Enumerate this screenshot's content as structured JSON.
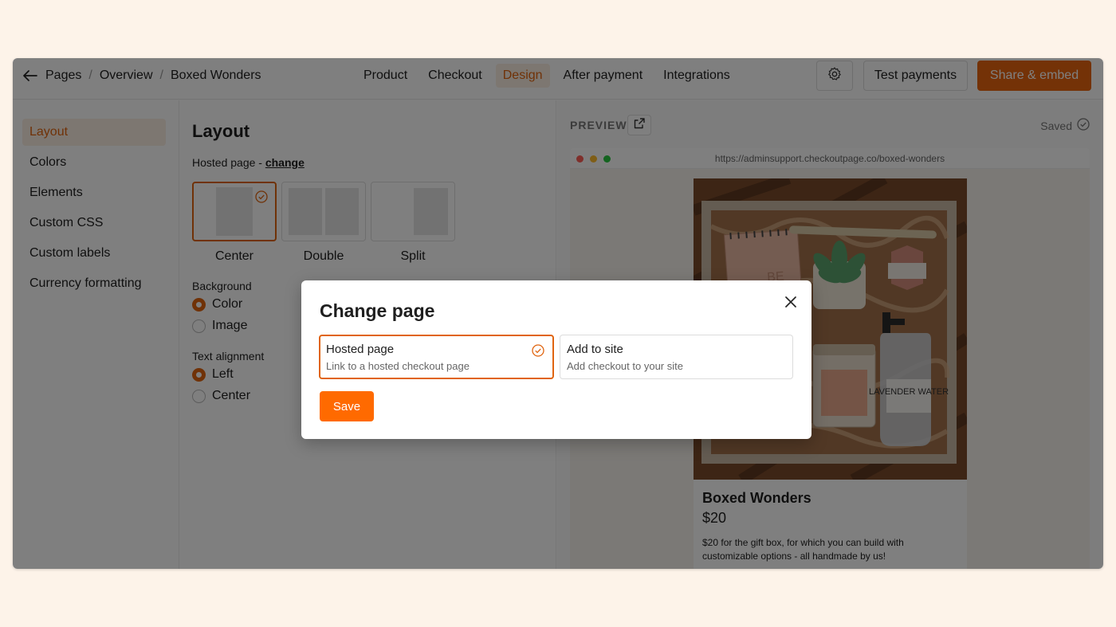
{
  "breadcrumb": [
    "Pages",
    "Overview",
    "Boxed Wonders"
  ],
  "nav_tabs": [
    {
      "label": "Product",
      "active": false
    },
    {
      "label": "Checkout",
      "active": false
    },
    {
      "label": "Design",
      "active": true
    },
    {
      "label": "After payment",
      "active": false
    },
    {
      "label": "Integrations",
      "active": false
    }
  ],
  "actions": {
    "settings_icon": "gear-icon",
    "test_payments": "Test payments",
    "share_embed": "Share & embed"
  },
  "sidebar": {
    "items": [
      {
        "label": "Layout",
        "active": true
      },
      {
        "label": "Colors"
      },
      {
        "label": "Elements"
      },
      {
        "label": "Custom CSS"
      },
      {
        "label": "Custom labels"
      },
      {
        "label": "Currency formatting"
      }
    ]
  },
  "panel": {
    "title": "Layout",
    "hosted_prefix": "Hosted page - ",
    "change_link": "change",
    "layouts": [
      {
        "label": "Center",
        "selected": true
      },
      {
        "label": "Double"
      },
      {
        "label": "Split"
      }
    ],
    "background_label": "Background",
    "background_options": [
      {
        "label": "Color",
        "checked": true
      },
      {
        "label": "Image",
        "checked": false
      }
    ],
    "alignment_label": "Text alignment",
    "alignment_options": [
      {
        "label": "Left",
        "checked": true
      },
      {
        "label": "Center",
        "checked": false
      }
    ]
  },
  "preview": {
    "label": "PREVIEW",
    "saved": "Saved",
    "url": "https://adminsupport.checkoutpage.co/boxed-wonders",
    "product": {
      "title": "Boxed Wonders",
      "price": "$20",
      "description": "$20 for the gift box, for which you can build with customizable options - all handmade by us!",
      "image_text": "LAVENDER WATER"
    }
  },
  "modal": {
    "title": "Change page",
    "options": [
      {
        "title": "Hosted page",
        "subtitle": "Link to a hosted checkout page",
        "selected": true
      },
      {
        "title": "Add to site",
        "subtitle": "Add checkout to your site",
        "selected": false
      }
    ],
    "save": "Save"
  },
  "colors": {
    "accent": "#e0640f",
    "save_button": "#ff6a00",
    "background": "#fdf3e9"
  }
}
